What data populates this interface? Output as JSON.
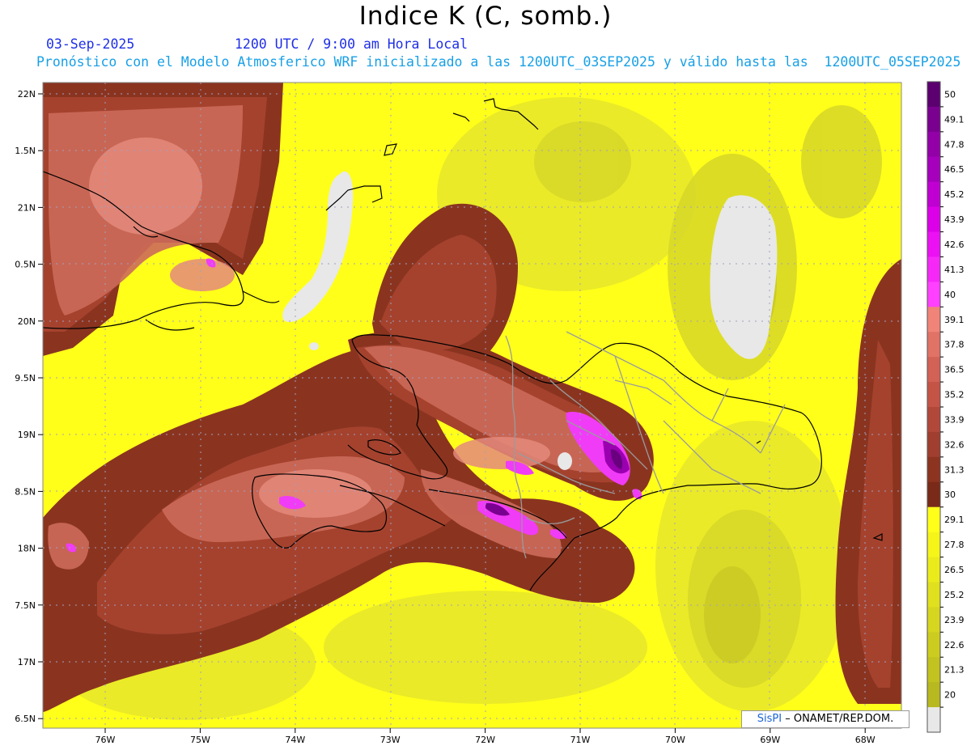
{
  "title": "Indice K (C, somb.)",
  "date_label": "03-Sep-2025",
  "time_label": "1200 UTC / 9:00 am Hora Local",
  "forecast_line": "Pronóstico con el Modelo Atmosferico WRF inicializado a las 1200UTC_03SEP2025 y válido hasta las  1200UTC_05SEP2025",
  "credit": {
    "logo": "SisPI",
    "text": "– ONAMET/REP.DOM."
  },
  "lat_labels": [
    "22N",
    "1.5N",
    "21N",
    "0.5N",
    "20N",
    "9.5N",
    "19N",
    "8.5N",
    "18N",
    "7.5N",
    "17N",
    "6.5N"
  ],
  "lon_labels": [
    "76W",
    "75W",
    "74W",
    "73W",
    "72W",
    "71W",
    "70W",
    "69W",
    "68W"
  ],
  "colorbar": {
    "levels": [
      "50",
      "49.1",
      "47.8",
      "46.5",
      "45.2",
      "43.9",
      "42.6",
      "41.3",
      "40",
      "39.1",
      "37.8",
      "36.5",
      "35.2",
      "33.9",
      "32.6",
      "31.3",
      "30",
      "29.1",
      "27.8",
      "26.5",
      "25.2",
      "23.9",
      "22.6",
      "21.3",
      "20"
    ],
    "colors": {
      "over_50": "#5c0070",
      "purple": [
        "#7a0090",
        "#9400a8",
        "#a600bc",
        "#c000d2",
        "#dc00e8",
        "#ec10f4",
        "#f528f8",
        "#ff40ff"
      ],
      "salmon": [
        "#f08478",
        "#e07266",
        "#d26256",
        "#c45446",
        "#b2483a",
        "#a03e30",
        "#8c3420",
        "#7a2a18"
      ],
      "yellow": [
        "#ffff1a",
        "#f5f51a",
        "#ebeb1c",
        "#e0e01e",
        "#d6d620",
        "#cccc20",
        "#c2c220",
        "#b8b820"
      ],
      "under_20": "#e8e8e8"
    }
  },
  "legend": {
    "variable": "Indice K",
    "units": "C",
    "range": [
      20,
      50
    ]
  }
}
